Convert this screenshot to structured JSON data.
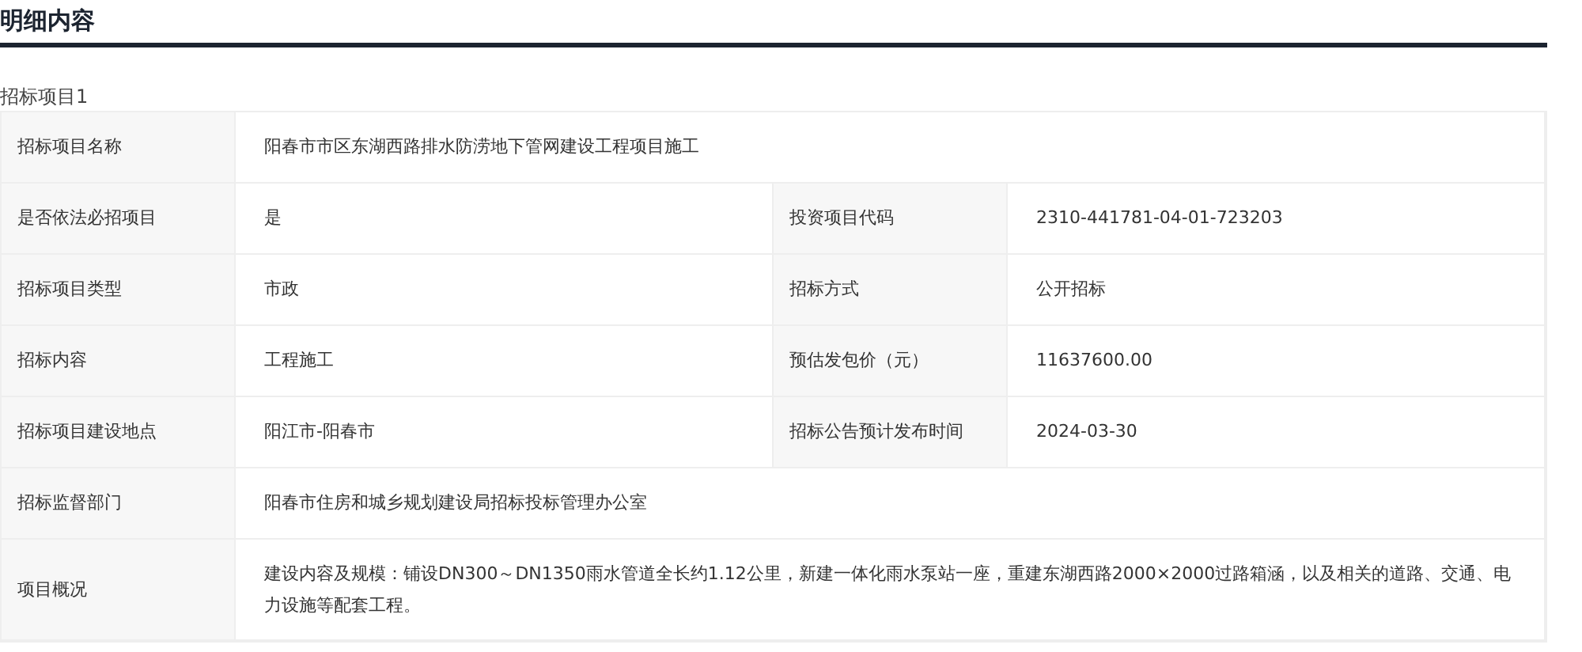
{
  "section_title": "明细内容",
  "subsection_title": "招标项目1",
  "rows": [
    {
      "fields": [
        {
          "label": "招标项目名称",
          "value": "阳春市市区东湖西路排水防涝地下管网建设工程项目施工"
        }
      ]
    },
    {
      "fields": [
        {
          "label": "是否依法必招项目",
          "value": "是"
        },
        {
          "label": "投资项目代码",
          "value": "2310-441781-04-01-723203"
        }
      ]
    },
    {
      "fields": [
        {
          "label": "招标项目类型",
          "value": "市政"
        },
        {
          "label": "招标方式",
          "value": "公开招标"
        }
      ]
    },
    {
      "fields": [
        {
          "label": "招标内容",
          "value": "工程施工"
        },
        {
          "label": "预估发包价（元）",
          "value": "11637600.00"
        }
      ]
    },
    {
      "fields": [
        {
          "label": "招标项目建设地点",
          "value": "阳江市-阳春市"
        },
        {
          "label": "招标公告预计发布时间",
          "value": "2024-03-30"
        }
      ]
    },
    {
      "fields": [
        {
          "label": "招标监督部门",
          "value": "阳春市住房和城乡规划建设局招标投标管理办公室"
        }
      ]
    },
    {
      "fields": [
        {
          "label": "项目概况",
          "value": "建设内容及规模：铺设DN300～DN1350雨水管道全长约1.12公里，新建一体化雨水泵站一座，重建东湖西路2000×2000过路箱涵，以及相关的道路、交通、电力设施等配套工程。"
        }
      ]
    }
  ]
}
